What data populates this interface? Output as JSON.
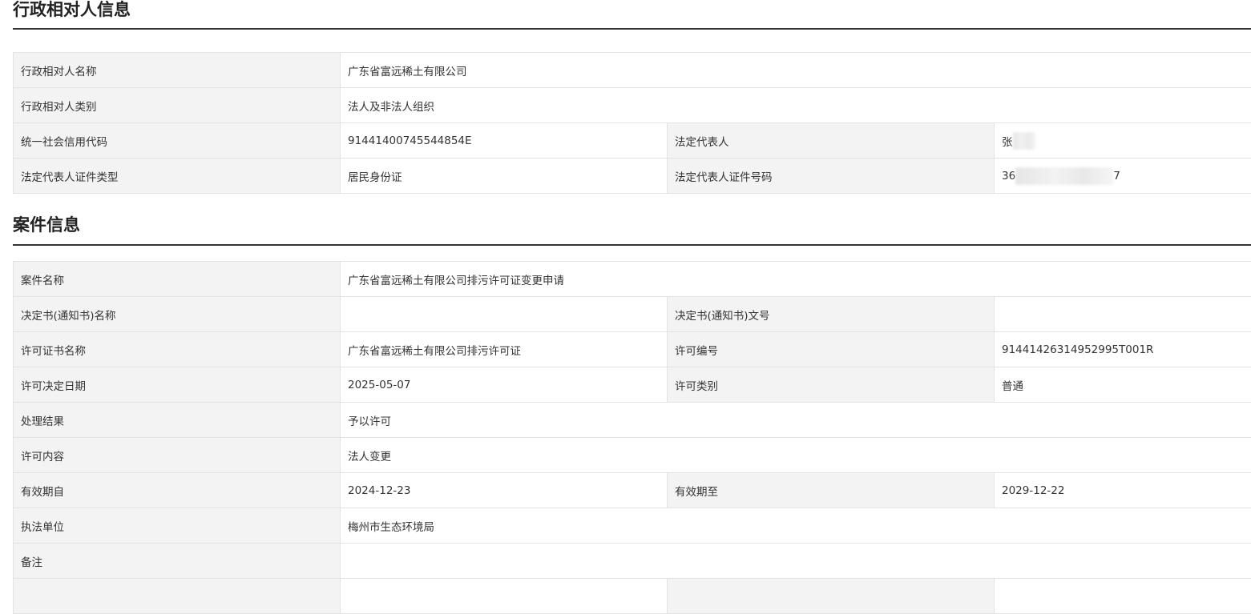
{
  "party_section": {
    "title": "行政相对人信息",
    "name_label": "行政相对人名称",
    "name_value": "广东省富远稀土有限公司",
    "category_label": "行政相对人类别",
    "category_value": "法人及非法人组织",
    "credit_code_label": "统一社会信用代码",
    "credit_code_value": "91441400745544854E",
    "legal_rep_label": "法定代表人",
    "legal_rep_value_visible": "张",
    "id_type_label": "法定代表人证件类型",
    "id_type_value": "居民身份证",
    "id_number_label": "法定代表人证件号码",
    "id_number_prefix": "36",
    "id_number_suffix": "7"
  },
  "case_section": {
    "title": "案件信息",
    "case_name_label": "案件名称",
    "case_name_value": "广东省富远稀土有限公司排污许可证变更申请",
    "decision_name_label": "决定书(通知书)名称",
    "decision_name_value": "",
    "decision_no_label": "决定书(通知书)文号",
    "decision_no_value": "",
    "license_name_label": "许可证书名称",
    "license_name_value": "广东省富远稀土有限公司排污许可证",
    "license_no_label": "许可编号",
    "license_no_value": "91441426314952995T001R",
    "decision_date_label": "许可决定日期",
    "decision_date_value": "2025-05-07",
    "license_type_label": "许可类别",
    "license_type_value": "普通",
    "result_label": "处理结果",
    "result_value": "予以许可",
    "content_label": "许可内容",
    "content_value": "法人变更",
    "valid_from_label": "有效期自",
    "valid_from_value": "2024-12-23",
    "valid_to_label": "有效期至",
    "valid_to_value": "2029-12-22",
    "authority_label": "执法单位",
    "authority_value": "梅州市生态环境局",
    "remark_label": "备注",
    "remark_value": ""
  }
}
